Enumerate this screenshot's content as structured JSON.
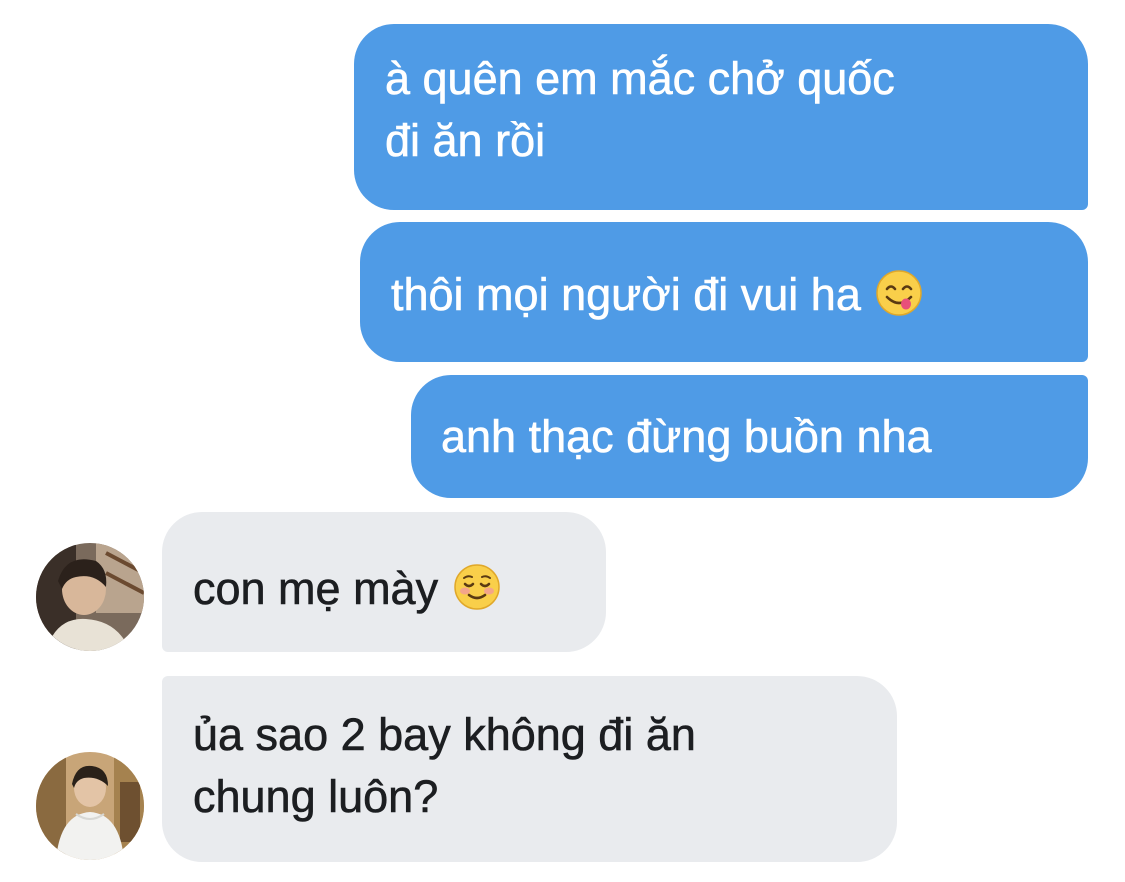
{
  "colors": {
    "outgoing_bubble": "#4f9be6",
    "incoming_bubble": "#e9ebee",
    "outgoing_text": "#ffffff",
    "incoming_text": "#1c1e21"
  },
  "messages": [
    {
      "direction": "outgoing",
      "line1": "à quên em mắc chở quốc",
      "line2": "đi ăn rồi"
    },
    {
      "direction": "outgoing",
      "text": "thôi mọi người đi vui ha",
      "emoji": "face-savoring-food"
    },
    {
      "direction": "outgoing",
      "text": "anh thạc đừng buồn nha"
    },
    {
      "direction": "incoming",
      "text": "con mẹ mày",
      "emoji": "smiling-face"
    },
    {
      "direction": "incoming",
      "line1": "ủa sao 2 bay không đi ăn",
      "line2": "chung luôn?"
    }
  ]
}
